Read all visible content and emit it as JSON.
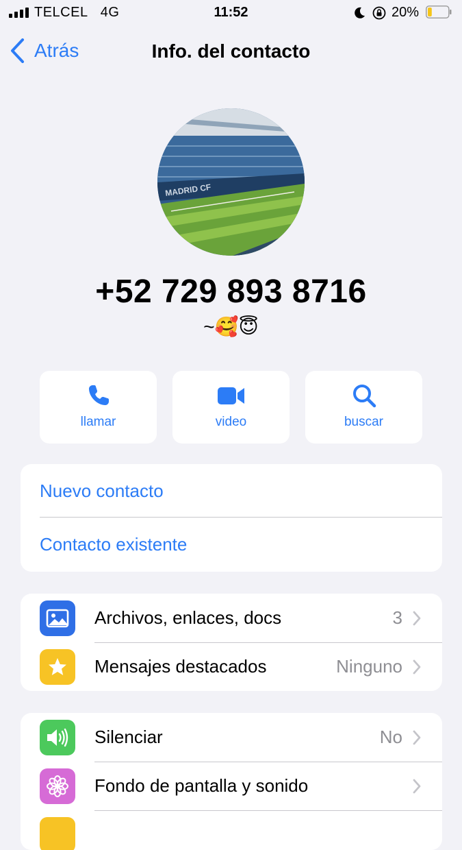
{
  "status": {
    "carrier": "TELCEL",
    "network": "4G",
    "time": "11:52",
    "battery": "20%",
    "battery_level": 0.2
  },
  "nav": {
    "back_label": "Atrás",
    "title": "Info. del contacto"
  },
  "contact": {
    "phone": "+52 729 893 8716",
    "about": "~🥰😇"
  },
  "actions": [
    {
      "label": "llamar",
      "icon": "phone-icon"
    },
    {
      "label": "video",
      "icon": "video-camera-icon"
    },
    {
      "label": "buscar",
      "icon": "search-icon"
    }
  ],
  "contact_links": [
    {
      "label": "Nuevo contacto"
    },
    {
      "label": "Contacto existente"
    }
  ],
  "media_section": [
    {
      "label": "Archivos, enlaces, docs",
      "value": "3",
      "icon": "photo-icon",
      "color": "#2f6fe6"
    },
    {
      "label": "Mensajes destacados",
      "value": "Ninguno",
      "icon": "star-icon",
      "color": "#f7c325"
    }
  ],
  "settings_section": [
    {
      "label": "Silenciar",
      "value": "No",
      "icon": "speaker-icon",
      "color": "#4cc95c"
    },
    {
      "label": "Fondo de pantalla y sonido",
      "value": "",
      "icon": "flower-icon",
      "color": "#d66bd6"
    }
  ],
  "colors": {
    "accent": "#2c7cf6",
    "background": "#f2f2f7",
    "secondary_text": "#8e8e93"
  }
}
